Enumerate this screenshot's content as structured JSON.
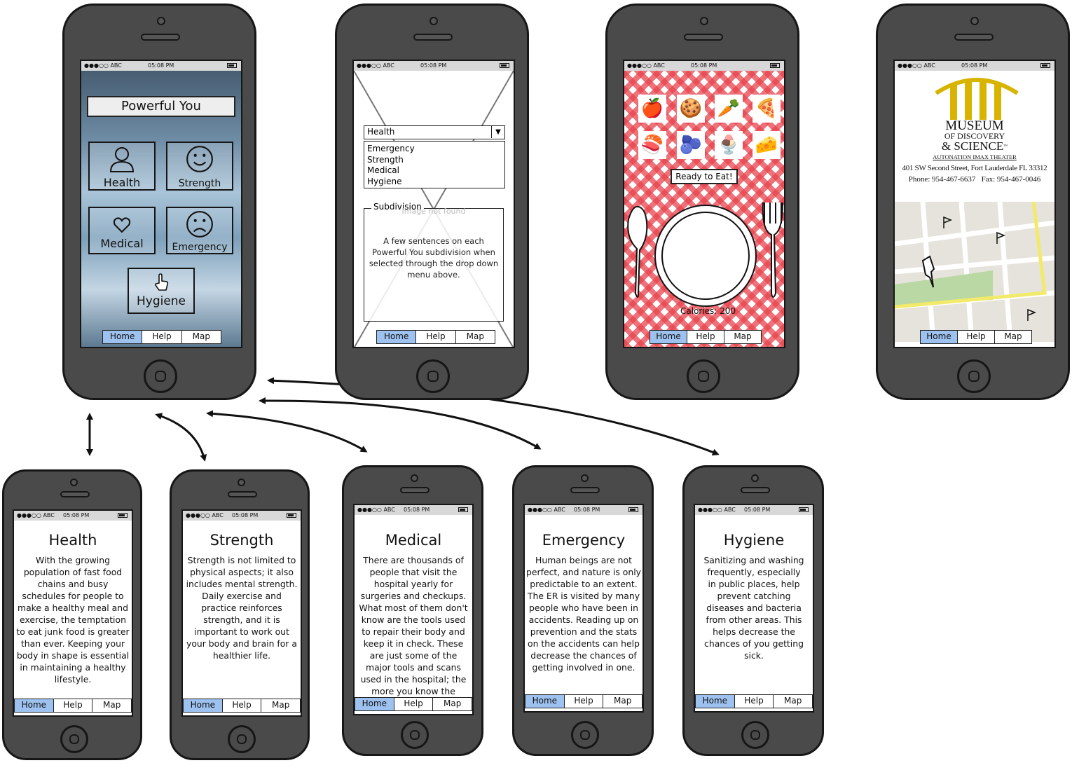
{
  "status_bar": {
    "signal": "●●●○○ ABC",
    "time": "05:08 PM"
  },
  "tabs": [
    "Home",
    "Help",
    "Map"
  ],
  "home_screen": {
    "title": "Powerful You",
    "tiles": [
      {
        "label": "Health",
        "icon": "person-icon"
      },
      {
        "label": "Strength",
        "icon": "smiley-icon"
      },
      {
        "label": "Medical",
        "icon": "heart-icon"
      },
      {
        "label": "Emergency",
        "icon": "sad-face-icon"
      },
      {
        "label": "Hygiene",
        "icon": "hand-pointer-icon"
      }
    ]
  },
  "subdivision_screen": {
    "dropdown_value": "Health",
    "dropdown_options": [
      "Emergency",
      "Strength",
      "Medical",
      "Hygiene"
    ],
    "panel_title": "Subdivision",
    "image_placeholder": "Image not found",
    "description": "A few sentences on each Powerful You subdivision when selected through the drop down menu above."
  },
  "food_screen": {
    "foods": [
      "apple-icon",
      "cookie-icon",
      "carrot-icon",
      "pizza-icon",
      "salmon-icon",
      "blueberries-icon",
      "ice-cream-icon",
      "mac-and-cheese-icon"
    ],
    "button_label": "Ready to Eat!",
    "calories_text": "Calories: 200"
  },
  "map_screen": {
    "logo_line1": "MUSEUM",
    "logo_line2": "OF DISCOVERY",
    "logo_line3": "& SCIENCE",
    "logo_tm": "™",
    "logo_subtitle": "AUTONATION IMAX THEATER",
    "address": "401 SW Second Street, Fort Lauderdale FL 33312",
    "phone": "Phone: 954-467-6637",
    "fax": "Fax: 954-467-0046"
  },
  "detail_screens": [
    {
      "title": "Health",
      "body": "With the growing population of fast food chains and busy schedules for people to make a healthy meal and exercise, the temptation to eat junk food is greater than ever. Keeping your body in shape is essential in maintaining a healthy lifestyle."
    },
    {
      "title": "Strength",
      "body": "Strength is not limited to physical aspects; it also includes mental strength. Daily exercise and practice reinforces strength, and it is important to work out your body and brain for a healthier life."
    },
    {
      "title": "Medical",
      "body": "There are thousands of people that visit the hospital yearly for surgeries and checkups. What most of them don't know are the tools used to repair their body and keep it in check. These are just some of the major tools and scans used in the hospital; the more you know the better."
    },
    {
      "title": "Emergency",
      "body": "Human beings are not perfect, and nature is only predictable to an extent. The ER is visited by many people who have been in accidents. Reading up on prevention and the stats on the accidents can help decrease the chances of getting involved in one."
    },
    {
      "title": "Hygiene",
      "body": "Sanitizing and washing frequently, especially in public places, help prevent catching diseases and bacteria from other areas. This helps decrease the chances of you getting sick."
    }
  ],
  "colors": {
    "phone_body": "#4a4a4a",
    "phone_outline": "#161616",
    "active_tab": "#9ec2f0",
    "tablecloth": "#e8434d",
    "map_road": "#f2ea6a",
    "map_park": "#b9d8a4",
    "museum_gold": "#d8b300"
  }
}
